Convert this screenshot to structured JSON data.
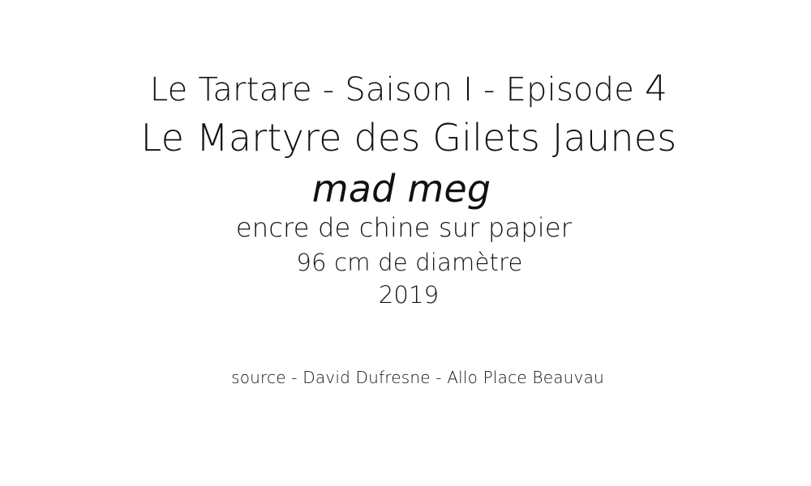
{
  "card": {
    "series_prefix": "Le Tartare - Saison I - Episode ",
    "episode_number": "4",
    "title": "Le Martyre des Gilets Jaunes",
    "artist": "mad meg",
    "medium": "encre de chine sur papier",
    "dimensions": "96 cm de diamètre",
    "year": "2019",
    "source": "source - David Dufresne - Allo Place Beauvau"
  }
}
